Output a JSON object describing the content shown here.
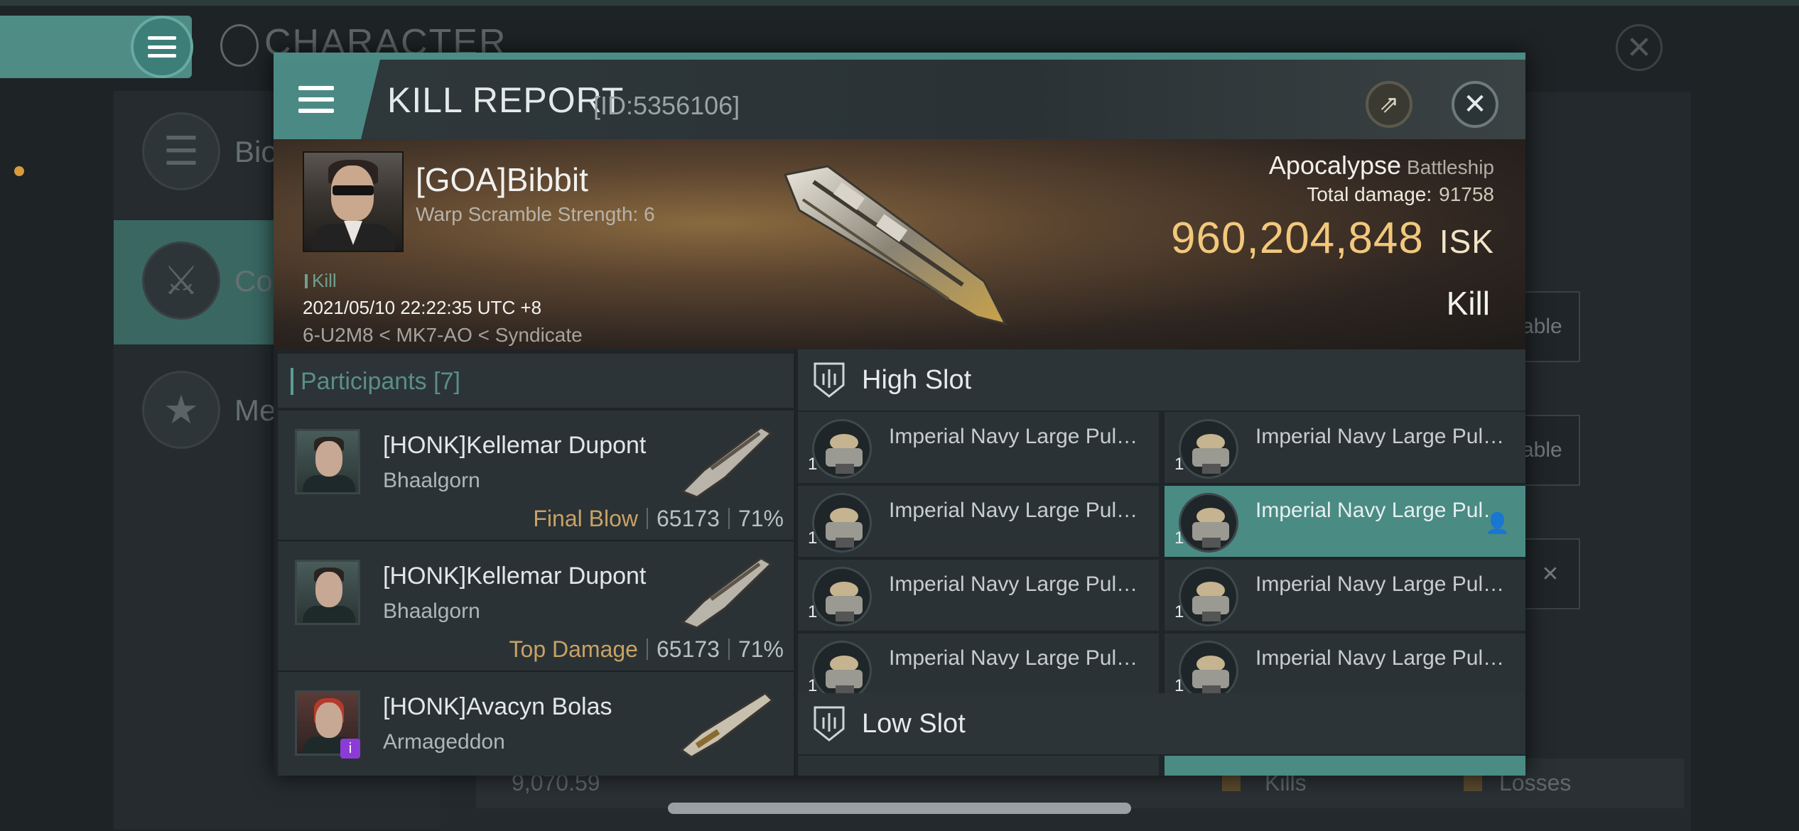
{
  "background": {
    "screen_title": "CHARACTER",
    "close_icon": "close-icon",
    "menu_icon": "menu-icon",
    "sidebar": [
      {
        "label": "Bio",
        "icon": "list-icon"
      },
      {
        "label": "Co",
        "icon": "crossed-swords-icon"
      },
      {
        "label": "Me",
        "icon": "star-badge-icon"
      }
    ],
    "right_buttons": [
      "able",
      "able"
    ],
    "bottom_bar": {
      "value": "9,070.59",
      "kills_label": "Kills",
      "losses_label": "Losses"
    }
  },
  "modal": {
    "title": "KILL REPORT",
    "id_label": "[ID:5356106]",
    "share_icon": "share-icon",
    "close_icon": "close-icon",
    "victim": {
      "name": "[GOA]Bibbit",
      "warp_scramble": "Warp Scramble Strength: 6",
      "kill_tag": "Kill",
      "datetime": "2021/05/10 22:22:35 UTC +8",
      "location": "6-U2M8 < MK7-AO < Syndicate",
      "ship_name": "Apocalypse",
      "ship_class": "Battleship",
      "total_damage_label": "Total damage:",
      "total_damage_value": "91758",
      "isk_value": "960,204,848",
      "isk_unit": "ISK",
      "result": "Kill"
    },
    "participants": {
      "header": "Participants [7]",
      "rows": [
        {
          "name": "[HONK]Kellemar Dupont",
          "ship": "Bhaalgorn",
          "tag": "Final Blow",
          "damage": "65173",
          "percent": "71%"
        },
        {
          "name": "[HONK]Kellemar Dupont",
          "ship": "Bhaalgorn",
          "tag": "Top Damage",
          "damage": "65173",
          "percent": "71%"
        },
        {
          "name": "[HONK]Avacyn Bolas",
          "ship": "Armageddon",
          "tag": "",
          "damage": "",
          "percent": ""
        }
      ]
    },
    "high_slot": {
      "label": "High Slot",
      "items": [
        {
          "name": "Imperial Navy Large Pulse...",
          "qty": "1",
          "status": "destroyed"
        },
        {
          "name": "Imperial Navy Large Pulse...",
          "qty": "1",
          "status": "destroyed"
        },
        {
          "name": "Imperial Navy Large Pulse...",
          "qty": "1",
          "status": "destroyed"
        },
        {
          "name": "Imperial Navy Large Pulse...",
          "qty": "1",
          "status": "dropped"
        },
        {
          "name": "Imperial Navy Large Pulse...",
          "qty": "1",
          "status": "destroyed"
        },
        {
          "name": "Imperial Navy Large Pulse...",
          "qty": "1",
          "status": "destroyed"
        },
        {
          "name": "Imperial Navy Large Pulse...",
          "qty": "1",
          "status": "destroyed"
        },
        {
          "name": "Imperial Navy Large Pulse...",
          "qty": "1",
          "status": "destroyed"
        }
      ]
    },
    "low_slot": {
      "label": "Low Slot"
    }
  }
}
